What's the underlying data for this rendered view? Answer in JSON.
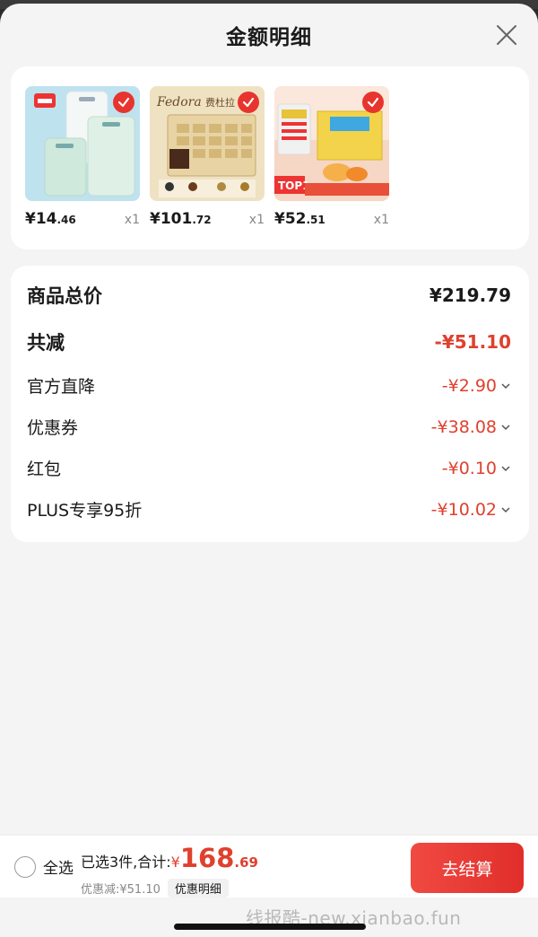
{
  "header": {
    "title": "金额明细"
  },
  "products": [
    {
      "price_int": "¥14",
      "price_dec": ".46",
      "qty": "x1",
      "image_icon": "clear-bag-product-icon"
    },
    {
      "price_int": "¥101",
      "price_dec": ".72",
      "qty": "x1",
      "image_icon": "chocolate-box-product-icon"
    },
    {
      "price_int": "¥52",
      "price_dec": ".51",
      "qty": "x1",
      "image_icon": "egg-box-product-icon"
    }
  ],
  "summary": {
    "total_label": "商品总价",
    "total_value": "¥219.79",
    "reduce_label": "共减",
    "reduce_value": "-¥51.10",
    "items": [
      {
        "label": "官方直降",
        "value": "-¥2.90"
      },
      {
        "label": "优惠券",
        "value": "-¥38.08"
      },
      {
        "label": "红包",
        "value": "-¥0.10"
      },
      {
        "label": "PLUS专享95折",
        "value": "-¥10.02"
      }
    ]
  },
  "bottom_bar": {
    "select_all": "全选",
    "selected_text": "已选3件,合计:",
    "currency": "¥",
    "total_int": "168",
    "total_dec": ".69",
    "discount_text": "优惠减:¥51.10",
    "detail_chip": "优惠明细",
    "checkout": "去结算"
  },
  "watermark": "线报酷-new.xianbao.fun",
  "colors": {
    "accent_red": "#e0402e",
    "button_red": "#e12e2a",
    "sheet_bg": "#f4f4f4"
  }
}
